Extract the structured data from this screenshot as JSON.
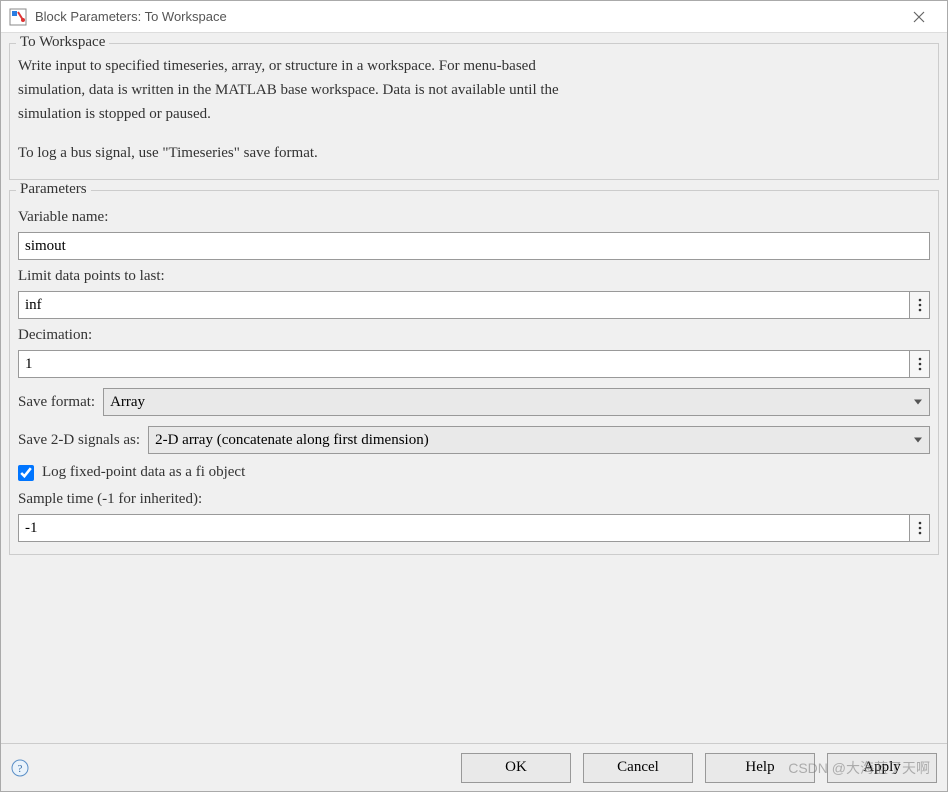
{
  "window": {
    "title": "Block Parameters: To Workspace"
  },
  "group1": {
    "legend": "To Workspace",
    "desc_line1": "Write input to specified timeseries, array, or structure in a workspace. For menu-based",
    "desc_line2": "simulation, data is written in the MATLAB base workspace. Data is not available until the",
    "desc_line3": "simulation is stopped or paused.",
    "desc_line4": "To log a bus signal, use \"Timeseries\" save format."
  },
  "group2": {
    "legend": "Parameters",
    "variable_name_label": "Variable name:",
    "variable_name_value": "simout",
    "limit_label": "Limit data points to last:",
    "limit_value": "inf",
    "decimation_label": "Decimation:",
    "decimation_value": "1",
    "save_format_label": "Save format:",
    "save_format_value": "Array",
    "save_2d_label": "Save 2-D signals as:",
    "save_2d_value": "2-D array (concatenate along first dimension)",
    "log_fixed_label": "Log fixed-point data as a fi object",
    "sample_time_label": "Sample time (-1 for inherited):",
    "sample_time_value": "-1"
  },
  "buttons": {
    "ok": "OK",
    "cancel": "Cancel",
    "help": "Help",
    "apply": "Apply"
  },
  "watermark": "CSDN @大海蓝了天啊"
}
